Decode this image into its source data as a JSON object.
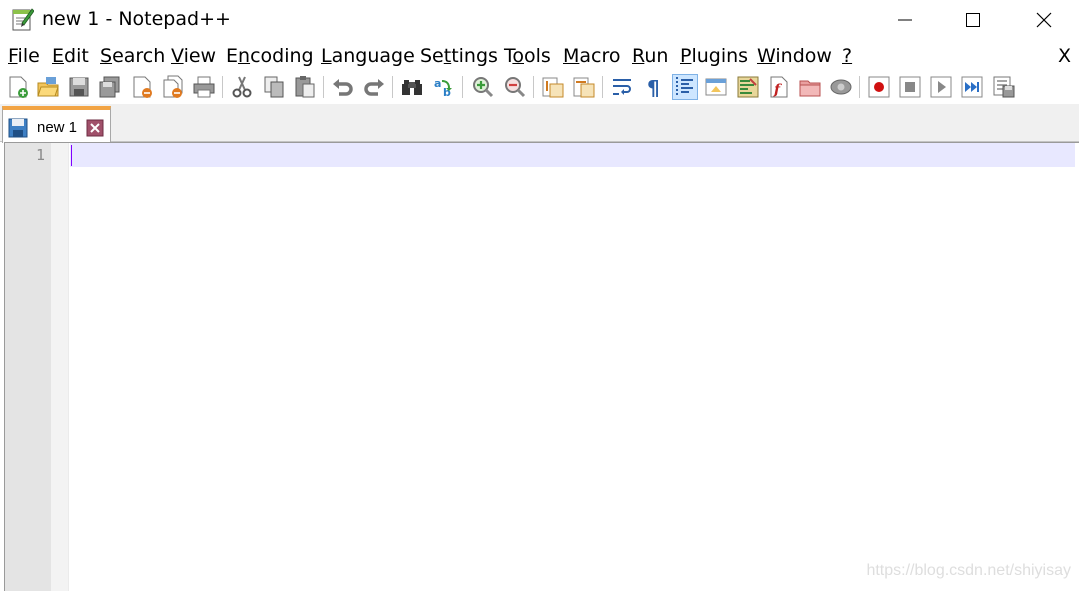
{
  "window": {
    "title": "new 1 - Notepad++"
  },
  "menu": {
    "items": [
      {
        "mnemonic": "F",
        "rest": "ile"
      },
      {
        "mnemonic": "E",
        "rest": "dit"
      },
      {
        "mnemonic": "S",
        "rest": "earch"
      },
      {
        "mnemonic": "V",
        "rest": "iew"
      },
      {
        "mnemonic": "",
        "rest": "Encoding"
      },
      {
        "mnemonic": "L",
        "rest": "anguage"
      },
      {
        "mnemonic": "",
        "rest": "Settings"
      },
      {
        "mnemonic": "",
        "rest": "Tools"
      },
      {
        "mnemonic": "M",
        "rest": "acro"
      },
      {
        "mnemonic": "R",
        "rest": "un"
      },
      {
        "mnemonic": "P",
        "rest": "lugins"
      },
      {
        "mnemonic": "W",
        "rest": "indow"
      },
      {
        "mnemonic": "?",
        "rest": ""
      }
    ],
    "close_label": "X"
  },
  "tabs": [
    {
      "label": "new 1"
    }
  ],
  "editor": {
    "line_numbers": [
      "1"
    ],
    "content": ""
  },
  "watermark": "https://blog.csdn.net/shiyisay",
  "colors": {
    "current_line": "#e8e8ff",
    "caret": "#8000ff",
    "tab_accent": "#f2a444"
  }
}
